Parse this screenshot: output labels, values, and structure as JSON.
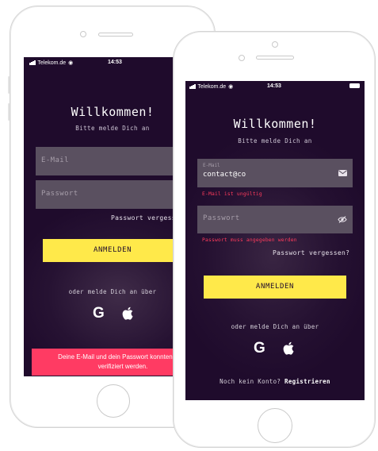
{
  "status": {
    "carrier": "Telekom.de",
    "time": "14:53"
  },
  "left": {
    "title": "Willkommen!",
    "subtitle": "Bitte melde Dich an",
    "email_placeholder": "E-Mail",
    "password_placeholder": "Passwort",
    "forgot_label": "Passwort vergessen?",
    "login_button": "ANMELDEN",
    "alt_login_label": "oder melde Dich an über",
    "google_label": "G",
    "error_line1": "Deine E-Mail und dein Passwort konnten nicht",
    "error_line2": "verifiziert werden."
  },
  "right": {
    "title": "Willkommen!",
    "subtitle": "Bitte melde Dich an",
    "email_label": "E-Mail",
    "email_value": "contact@co",
    "email_error": "E-Mail ist ungültig",
    "password_placeholder": "Passwort",
    "password_error": "Passwort muss angegeben werden",
    "forgot_label": "Passwort vergessen?",
    "login_button": "ANMELDEN",
    "alt_login_label": "oder melde Dich an über",
    "google_label": "G",
    "register_prompt": "Noch kein Konto?",
    "register_link": "Registrieren"
  },
  "colors": {
    "screen_bg": "#1f0b2c",
    "accent_yellow": "#ffe94a",
    "error_red": "#ff3b5c",
    "field_bg": "#5a5060"
  },
  "icons": {
    "email_field": "envelope-icon",
    "password_field": "eye-slash-icon",
    "social": [
      "google-icon",
      "apple-icon"
    ]
  }
}
